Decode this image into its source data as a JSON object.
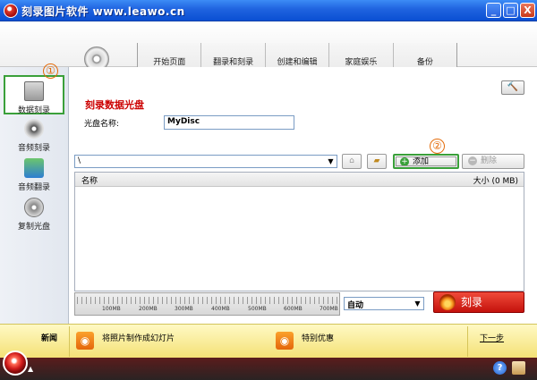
{
  "window": {
    "title": "刻录图片软件 www.leawo.cn",
    "minimize": "_",
    "maximize": "□",
    "close": "X"
  },
  "nav": {
    "tabs": [
      "开始页面",
      "翻录和刻录",
      "创建和编辑",
      "家庭娱乐",
      "备份"
    ]
  },
  "sidebar": {
    "items": [
      {
        "label": "数据刻录",
        "icon": "data-disc-icon",
        "active": true
      },
      {
        "label": "音频刻录",
        "icon": "audio-disc-icon",
        "active": false
      },
      {
        "label": "音频翻录",
        "icon": "audio-rip-icon",
        "active": false
      },
      {
        "label": "复制光盘",
        "icon": "copy-disc-icon",
        "active": false
      }
    ]
  },
  "main": {
    "section_title": "刻录数据光盘",
    "disc_name_label": "光盘名称:",
    "disc_name_value": "MyDisc",
    "path_value": "\\",
    "add_label": "添加",
    "delete_label": "删除",
    "columns": {
      "name": "名称",
      "size": "大小 (0 MB)"
    },
    "capacity": {
      "used_fraction": 0.0,
      "ticks": [
        "100MB",
        "200MB",
        "300MB",
        "400MB",
        "500MB",
        "600MB",
        "700MB"
      ]
    },
    "speed_value": "自动",
    "burn_label": "刻录"
  },
  "callouts": [
    "①",
    "②"
  ],
  "news": {
    "label": "新闻",
    "item1": "将照片制作成幻灯片",
    "item2": "特别优惠",
    "next": "下一步"
  },
  "colors": {
    "title_bar": "#1f63df",
    "accent_red": "#cc0000",
    "highlight_green": "#3aa03a",
    "callout_orange": "#e46c0a",
    "news_bg": "#fff9c4"
  }
}
